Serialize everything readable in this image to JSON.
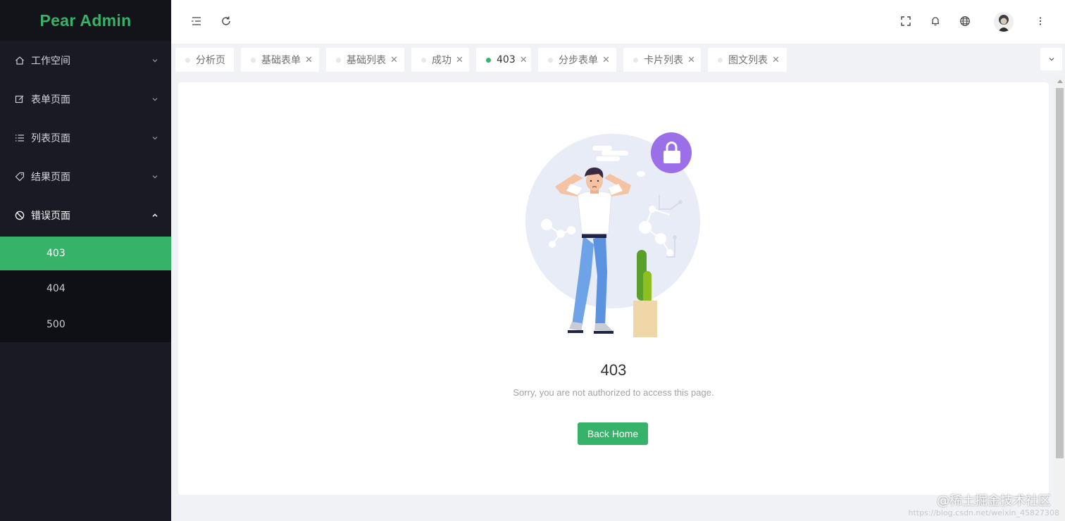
{
  "app": {
    "title": "Pear Admin"
  },
  "sidebar": {
    "items": [
      {
        "label": "工作空间",
        "icon": "home-icon"
      },
      {
        "label": "表单页面",
        "icon": "edit-icon"
      },
      {
        "label": "列表页面",
        "icon": "list-icon"
      },
      {
        "label": "结果页面",
        "icon": "tag-icon"
      },
      {
        "label": "错误页面",
        "icon": "ban-icon",
        "open": true
      }
    ],
    "sub_items": [
      {
        "label": "403",
        "active": true
      },
      {
        "label": "404"
      },
      {
        "label": "500"
      }
    ]
  },
  "header": {
    "icons": [
      "menu-fold-icon",
      "refresh-icon",
      "fullscreen-icon",
      "bell-icon",
      "globe-icon",
      "avatar",
      "more-vertical-icon"
    ]
  },
  "tabs": [
    {
      "label": "分析页",
      "closable": false
    },
    {
      "label": "基础表单",
      "closable": true
    },
    {
      "label": "基础列表",
      "closable": true
    },
    {
      "label": "成功",
      "closable": true
    },
    {
      "label": "403",
      "closable": true,
      "active": true
    },
    {
      "label": "分步表单",
      "closable": true
    },
    {
      "label": "卡片列表",
      "closable": true
    },
    {
      "label": "图文列表",
      "closable": true
    }
  ],
  "content": {
    "code": "403",
    "message": "Sorry, you are not authorized to access this page.",
    "button_label": "Back Home"
  },
  "watermark": {
    "text": "@稀土掘金技术社区",
    "url": "https://blog.csdn.net/weixin_45827308"
  },
  "colors": {
    "accent": "#36b368",
    "sidebar_bg": "#191a23",
    "lock_purple": "#9b6fe8"
  }
}
